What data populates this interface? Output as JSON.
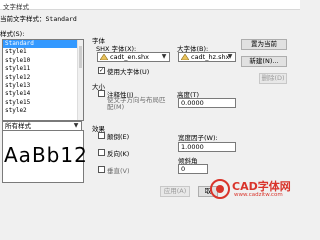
{
  "window": {
    "title": "文字样式"
  },
  "current_style": {
    "label": "当前文字样式：",
    "value": "Standard"
  },
  "styles_label": "样式(S):",
  "styles": [
    "Standard",
    "style1",
    "style10",
    "style11",
    "style12",
    "style13",
    "style14",
    "style15",
    "style2"
  ],
  "selected_style_index": 0,
  "filter": {
    "value": "所有样式"
  },
  "preview_text": "AaBb12",
  "font": {
    "group_label": "字体",
    "shx_label": "SHX 字体(X):",
    "shx_value": "cadt_en.shx",
    "big_label": "大字体(B):",
    "big_value": "cadt_hz.shx",
    "use_big_font_label": "使用大字体(U)",
    "use_big_font_checked": true
  },
  "size": {
    "group_label": "大小",
    "annotative_label": "注释性(I)",
    "annotative_checked": false,
    "match_orientation_label": "使文字方向与布局匹配(M)",
    "height_label": "高度(T)",
    "height_value": "0.0000"
  },
  "effects": {
    "group_label": "效果",
    "upside_down_label": "颠倒(E)",
    "backwards_label": "反向(K)",
    "vertical_label": "垂直(V)",
    "width_factor_label": "宽度因子(W):",
    "width_factor_value": "1.0000",
    "oblique_label": "倾斜角",
    "oblique_value": "0"
  },
  "buttons": {
    "set_current": "置为当前",
    "new": "新建(N)...",
    "delete": "删除(D)",
    "apply": "应用(A)",
    "cancel": "取"
  },
  "watermark": {
    "brand": "CAD字体网",
    "url": "www.cadzitw.com",
    "color": "#d9342b"
  }
}
